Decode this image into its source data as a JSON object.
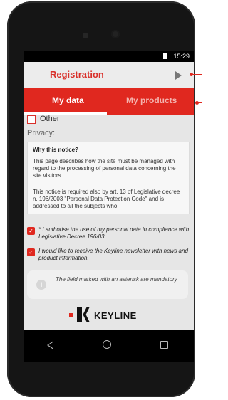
{
  "status_bar": {
    "time": "15:29"
  },
  "app_bar": {
    "title": "Registration"
  },
  "tabs": [
    {
      "label": "My data",
      "selected": true
    },
    {
      "label": "My products",
      "selected": false
    }
  ],
  "form": {
    "other_label": "Other",
    "privacy_label": "Privacy:",
    "notice": {
      "title": "Why this notice?",
      "paragraph1": "This page describes how the site must be managed with regard to the processing of personal data concerning the site visitors.",
      "paragraph2": "This notice is required also by art. 13 of Legislative decree n. 196/2003 \"Personal Data Protection Code\" and is addressed to all the subjects who"
    },
    "consents": [
      {
        "label": "* I authorise the use of my personal data in compliance with Legislative Decree 196/03",
        "checked": true
      },
      {
        "label": "I would like to receive the Keyline newsletter with news and product information.",
        "checked": true
      }
    ],
    "mandatory_note": "The field marked with an asterisk are mandatory"
  },
  "brand": {
    "name": "KEYLINE",
    "accent": "#e0281f"
  },
  "icons": {
    "forward": "play-icon",
    "info": "info-icon",
    "check": "checkbox-checked-icon",
    "nav_back": "back-triangle-icon",
    "nav_home": "home-circle-icon",
    "nav_recent": "recent-square-icon"
  }
}
